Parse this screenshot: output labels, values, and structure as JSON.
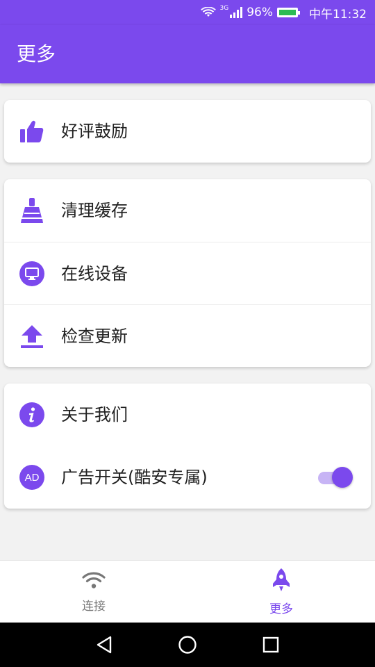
{
  "status_bar": {
    "network_label": "3G",
    "battery_percent": "96%",
    "time": "中午11:32",
    "battery_fill_color": "#2dbb54"
  },
  "app_bar": {
    "title": "更多",
    "background": "#7b49ed"
  },
  "cards": [
    {
      "items": [
        {
          "label": "好评鼓励",
          "icon": "thumbs-up-icon"
        }
      ]
    },
    {
      "items": [
        {
          "label": "清理缓存",
          "icon": "broom-icon"
        },
        {
          "label": "在线设备",
          "icon": "monitor-icon"
        },
        {
          "label": "检查更新",
          "icon": "upload-icon"
        }
      ]
    },
    {
      "items": [
        {
          "label": "关于我们",
          "icon": "info-icon"
        },
        {
          "label": "广告开关(酷安专属)",
          "icon": "ad-icon",
          "icon_text": "AD",
          "toggle_on": true
        }
      ]
    }
  ],
  "bottom_nav": {
    "items": [
      {
        "label": "连接",
        "icon": "wifi-icon",
        "selected": false
      },
      {
        "label": "更多",
        "icon": "rocket-icon",
        "selected": true
      }
    ]
  },
  "system_nav": {
    "buttons": [
      "back-icon",
      "home-icon",
      "recents-icon"
    ]
  },
  "accent_color": "#7b49ed"
}
